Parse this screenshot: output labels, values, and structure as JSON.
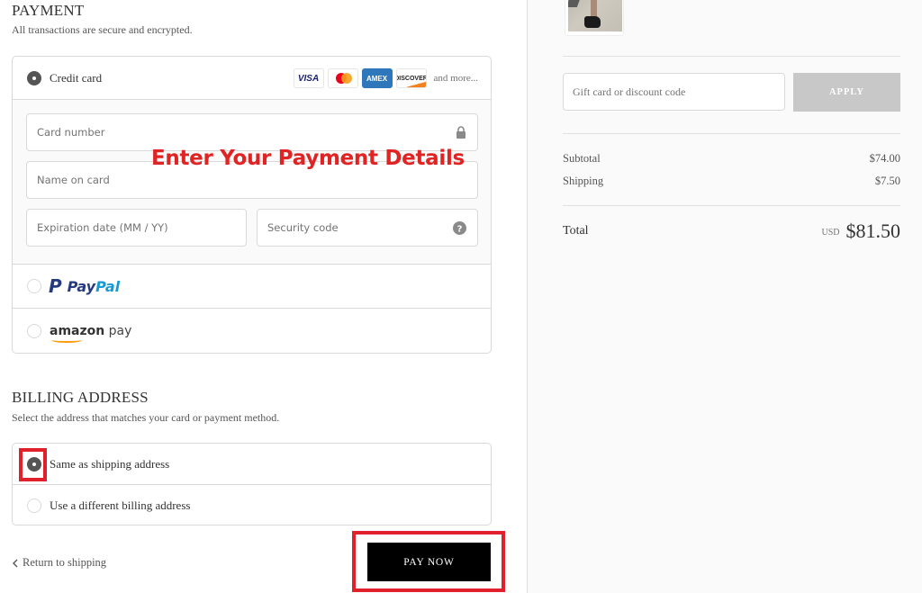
{
  "payment": {
    "title": "PAYMENT",
    "subtitle": "All transactions are secure and encrypted.",
    "methods": {
      "credit_card": {
        "label": "Credit card",
        "selected": true,
        "brands": [
          "VISA",
          "Mastercard",
          "AMEX",
          "DISCOVER"
        ],
        "and_more": "and more...",
        "fields": {
          "card_number": {
            "placeholder": "Card number",
            "value": ""
          },
          "name_on_card": {
            "placeholder": "Name on card",
            "value": ""
          },
          "expiration": {
            "placeholder": "Expiration date (MM / YY)",
            "value": ""
          },
          "security_code": {
            "placeholder": "Security code",
            "value": ""
          }
        }
      },
      "paypal": {
        "label_p": "P",
        "label_pay": "Pay",
        "label_pal": "Pal",
        "selected": false
      },
      "amazon_pay": {
        "label_amazon": "amazon",
        "label_pay": " pay",
        "selected": false
      }
    },
    "annotation": "Enter Your Payment Details"
  },
  "billing": {
    "title": "BILLING ADDRESS",
    "subtitle": "Select the address that matches your card or payment method.",
    "options": [
      {
        "label": "Same as shipping address",
        "selected": true
      },
      {
        "label": "Use a different billing address",
        "selected": false
      }
    ]
  },
  "footer": {
    "return_label": "Return to shipping",
    "pay_now_label": "PAY NOW"
  },
  "summary": {
    "discount_placeholder": "Gift card or discount code",
    "apply_label": "APPLY",
    "subtotal_label": "Subtotal",
    "subtotal_value": "$74.00",
    "shipping_label": "Shipping",
    "shipping_value": "$7.50",
    "total_label": "Total",
    "currency": "USD",
    "total_value": "$81.50"
  },
  "colors": {
    "highlight": "#e0202a",
    "primary_button": "#000000",
    "apply_disabled": "#c8c8c8"
  }
}
